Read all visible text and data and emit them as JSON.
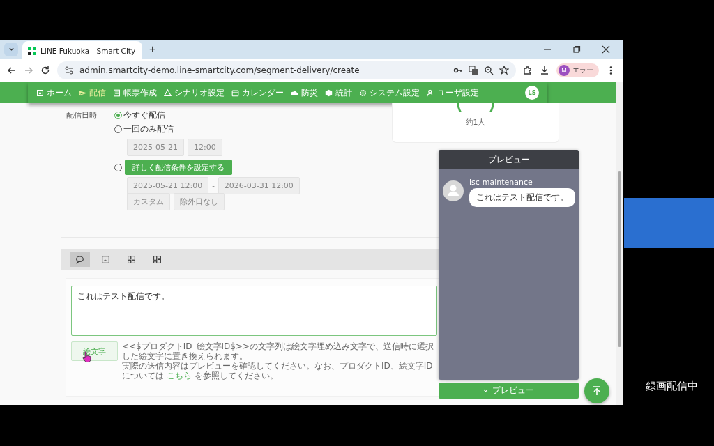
{
  "browser": {
    "tabs": [
      {
        "title": "LINE Fukuoka - Smart City",
        "selected": true
      }
    ],
    "new_tab": "+",
    "url": "admin.smartcity-demo.line-smartcity.com/segment-delivery/create",
    "profile": {
      "initial": "M",
      "label": "エラー"
    }
  },
  "nav": {
    "items": [
      {
        "label": "ホーム",
        "selected": false
      },
      {
        "label": "配信",
        "selected": true
      },
      {
        "label": "帳票作成",
        "selected": false
      },
      {
        "label": "シナリオ設定",
        "selected": false
      },
      {
        "label": "カレンダー",
        "selected": false
      },
      {
        "label": "防災",
        "selected": false
      },
      {
        "label": "統計",
        "selected": false
      },
      {
        "label": "システム設定",
        "selected": false
      },
      {
        "label": "ユーザ設定",
        "selected": false
      }
    ],
    "avatar": "LS"
  },
  "schedule": {
    "label": "配信日時",
    "options": [
      {
        "kind": "radio",
        "label": "今すぐ配信",
        "selected": true
      },
      {
        "kind": "radio",
        "label": "一回のみ配信",
        "selected": false,
        "fields": [
          "2025-05-21",
          "12:00"
        ]
      },
      {
        "kind": "button",
        "label": "詳しく配信条件を設定する",
        "selected": false,
        "range": [
          "2025-05-21 12:00",
          "2026-03-31 12:00"
        ],
        "separator": "-",
        "fields": [
          "カスタム",
          "除外日なし"
        ]
      }
    ]
  },
  "audience": {
    "count": "約1人"
  },
  "editor": {
    "tools": [
      {
        "kind": "speech",
        "selected": true
      },
      {
        "kind": "image",
        "selected": false
      },
      {
        "kind": "grid",
        "selected": false
      },
      {
        "kind": "grid-alt",
        "selected": false
      }
    ],
    "message": "これはテスト配信です。",
    "emoji_button": "絵文字",
    "hint": {
      "line_1": "<<$プロダクトID_絵文字ID$>>の文字列は絵文字埋め込み文字で、送信時に選択した絵文字に置き換えられます。",
      "line_2_before": "実際の送信内容はプレビューを確認してください。なお、プロダクトID、絵文字IDについては",
      "link": "こちら",
      "line_2_after": "を参照してください。"
    }
  },
  "preview": {
    "title": "プレビュー",
    "sender": "lsc-maintenance",
    "bubble": "これはテスト配信です。",
    "toggle_button": "プレビュー"
  },
  "overlay": {
    "recording": "録画配信中"
  }
}
